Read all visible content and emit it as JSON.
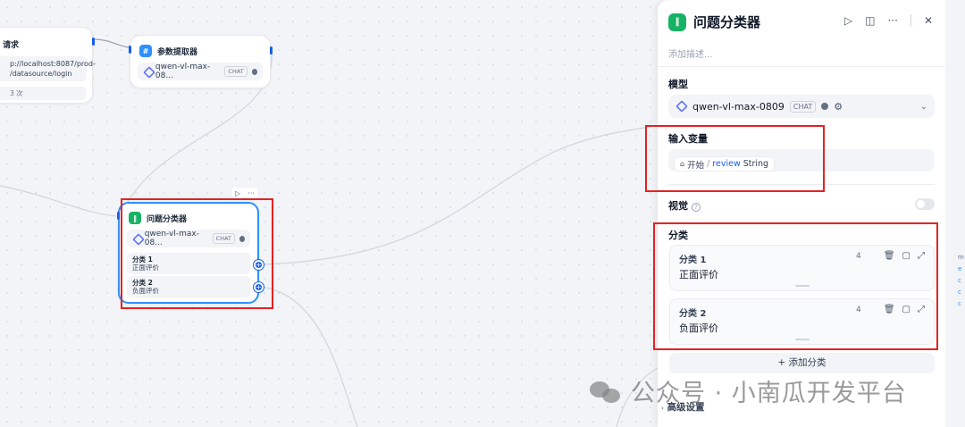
{
  "canvas": {
    "http_node": {
      "title": "请求",
      "url_line1": "p://localhost:8087/prod-",
      "url_line2": "/datasource/login",
      "retry": "3 次"
    },
    "param_node": {
      "title": "参数提取器",
      "model": "qwen-vl-max-08...",
      "badge": "CHAT"
    },
    "classifier_node": {
      "title": "问题分类器",
      "model": "qwen-vl-max-08...",
      "badge": "CHAT",
      "run_icon": "▷",
      "more_icon": "···",
      "classes": [
        {
          "name": "分类 1",
          "value": "正面评价"
        },
        {
          "name": "分类 2",
          "value": "负面评价"
        }
      ]
    }
  },
  "panel": {
    "title": "问题分类器",
    "description_placeholder": "添加描述...",
    "model_label": "模型",
    "model_name": "qwen-vl-max-0809",
    "model_badge": "CHAT",
    "input_label": "输入变量",
    "var_source": "开始",
    "var_sep": "/",
    "var_name": "review",
    "var_type": "String",
    "vision_label": "视觉",
    "class_label": "分类",
    "classes": [
      {
        "title": "分类 1",
        "count": "4",
        "value": "正面评价"
      },
      {
        "title": "分类 2",
        "count": "4",
        "value": "负面评价"
      }
    ],
    "add_class": "+ 添加分类",
    "advanced": "高级设置"
  },
  "watermark": {
    "text": "公众号 · 小南瓜开发平台"
  },
  "side_links": [
    "m",
    "e",
    "c",
    "c",
    "c"
  ],
  "colors": {
    "accent": "#155eef",
    "node_green": "#16b364",
    "highlight_red": "#e32222"
  }
}
